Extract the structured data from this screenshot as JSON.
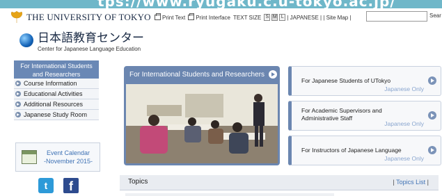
{
  "browser": {
    "url_fragment": "tps://www.ryugaku.c.u-tokyo.ac.jp/"
  },
  "header": {
    "university_name": "THE UNIVERSITY OF TOKYO",
    "toolbar": {
      "print_text": "Print Text",
      "print_interface": "Print Interface",
      "text_size_label": "TEXT SIZE",
      "sizes": [
        "S",
        "M",
        "L"
      ],
      "links": "| JAPANESE | | Site Map |",
      "search_placeholder": "",
      "search_label": "Sear"
    },
    "center_name_jp": "日本語教育センター",
    "center_name_en": "Center for Japanese Language Education"
  },
  "sidebar": {
    "heading": "For International Students and Researchers",
    "items": [
      {
        "label": "Course Information"
      },
      {
        "label": "Educational Activities"
      },
      {
        "label": "Additional Resources"
      },
      {
        "label": "Japanese Study Room"
      }
    ],
    "event_calendar": {
      "line1": "Event Calendar",
      "line2": "-November 2015-"
    }
  },
  "feature": {
    "title": "For International Students and Researchers"
  },
  "right_links": [
    {
      "title": "For Japanese Students of UTokyo",
      "sub": "Japanese Only"
    },
    {
      "title": "For Academic Supervisors and Administrative Staff",
      "sub": "Japanese Only"
    },
    {
      "title": "For Instructors of Japanese Language",
      "sub": "Japanese Only"
    }
  ],
  "topics": {
    "title": "Topics",
    "list_link": "Topics List"
  },
  "colors": {
    "accent": "#6b86b0",
    "link": "#3f72b5",
    "subtle_link": "#8aa6cf"
  }
}
